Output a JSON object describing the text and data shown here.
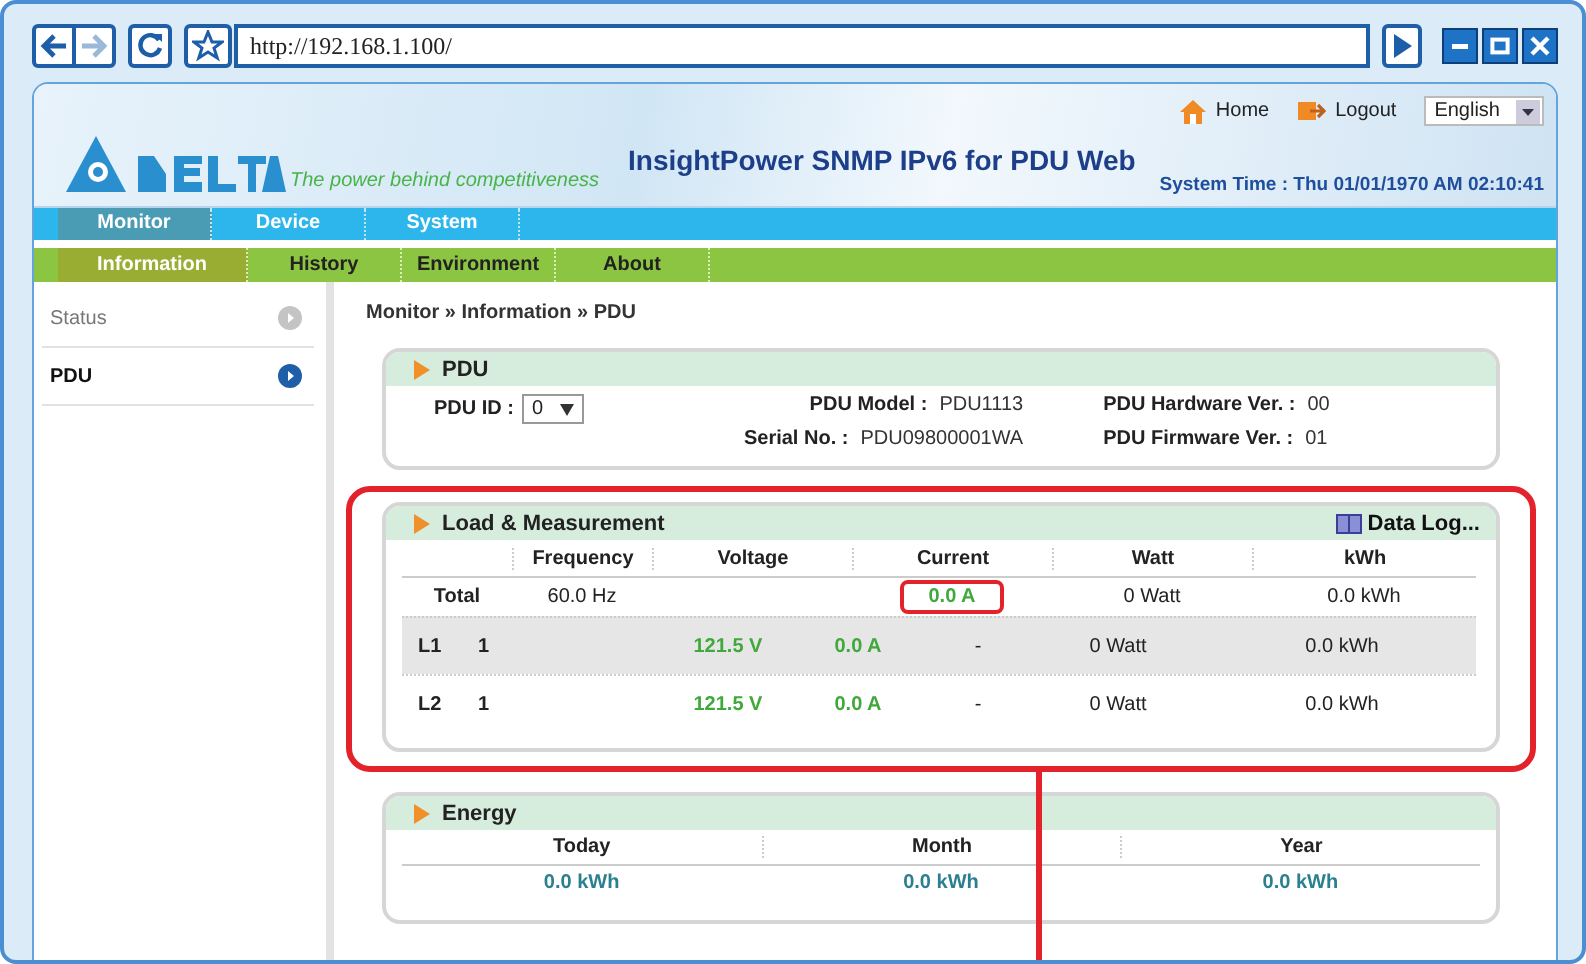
{
  "browser": {
    "url": "http://192.168.1.100/"
  },
  "header": {
    "slogan": "The power behind competitiveness",
    "title": "InsightPower SNMP IPv6 for PDU Web",
    "links": [
      {
        "kind": "home",
        "label": "Home"
      },
      {
        "kind": "logout",
        "label": "Logout"
      }
    ],
    "language": "English",
    "system_time": "System Time : Thu 01/01/1970 AM 02:10:41"
  },
  "main_menu": [
    {
      "label": "Monitor",
      "selected": true
    },
    {
      "label": "Device",
      "selected": false
    },
    {
      "label": "System",
      "selected": false
    }
  ],
  "sub_menu": [
    {
      "label": "Information",
      "selected": true
    },
    {
      "label": "History",
      "selected": false
    },
    {
      "label": "Environment",
      "selected": false
    },
    {
      "label": "About",
      "selected": false
    }
  ],
  "sidebar": {
    "items": [
      {
        "label": "Status",
        "selected": false
      },
      {
        "label": "PDU",
        "selected": true
      }
    ]
  },
  "breadcrumb": "Monitor » Information » PDU",
  "pdu_panel": {
    "title": "PDU",
    "pdu_id_label": "PDU ID :",
    "pdu_id": "0",
    "fields": [
      {
        "label": "PDU Model :",
        "value": "PDU1113"
      },
      {
        "label": "PDU Hardware Ver. :",
        "value": "00"
      },
      {
        "label": "Serial No. :",
        "value": "PDU09800001WA"
      },
      {
        "label": "PDU Firmware Ver. :",
        "value": "01"
      }
    ]
  },
  "load_panel": {
    "title": "Load & Measurement",
    "highlighted": true,
    "data_log": "Data Log...",
    "columns": [
      "Frequency",
      "Voltage",
      "Current",
      "Watt",
      "kWh"
    ],
    "total": {
      "label": "Total",
      "frequency": "60.0 Hz",
      "current": "0.0 A",
      "current_highlighted": true,
      "watt": "0 Watt",
      "kwh": "0.0 kWh"
    },
    "rows": [
      {
        "line": "L1",
        "number": "1",
        "voltage": "121.5 V",
        "current": "0.0 A",
        "extra": "-",
        "watt": "0 Watt",
        "kwh": "0.0 kWh",
        "shaded": true
      },
      {
        "line": "L2",
        "number": "1",
        "voltage": "121.5 V",
        "current": "0.0 A",
        "extra": "-",
        "watt": "0 Watt",
        "kwh": "0.0 kWh",
        "shaded": false
      }
    ]
  },
  "energy_panel": {
    "title": "Energy",
    "columns": [
      "Today",
      "Month",
      "Year"
    ],
    "values": [
      "0.0 kWh",
      "0.0 kWh",
      "0.0 kWh"
    ]
  }
}
